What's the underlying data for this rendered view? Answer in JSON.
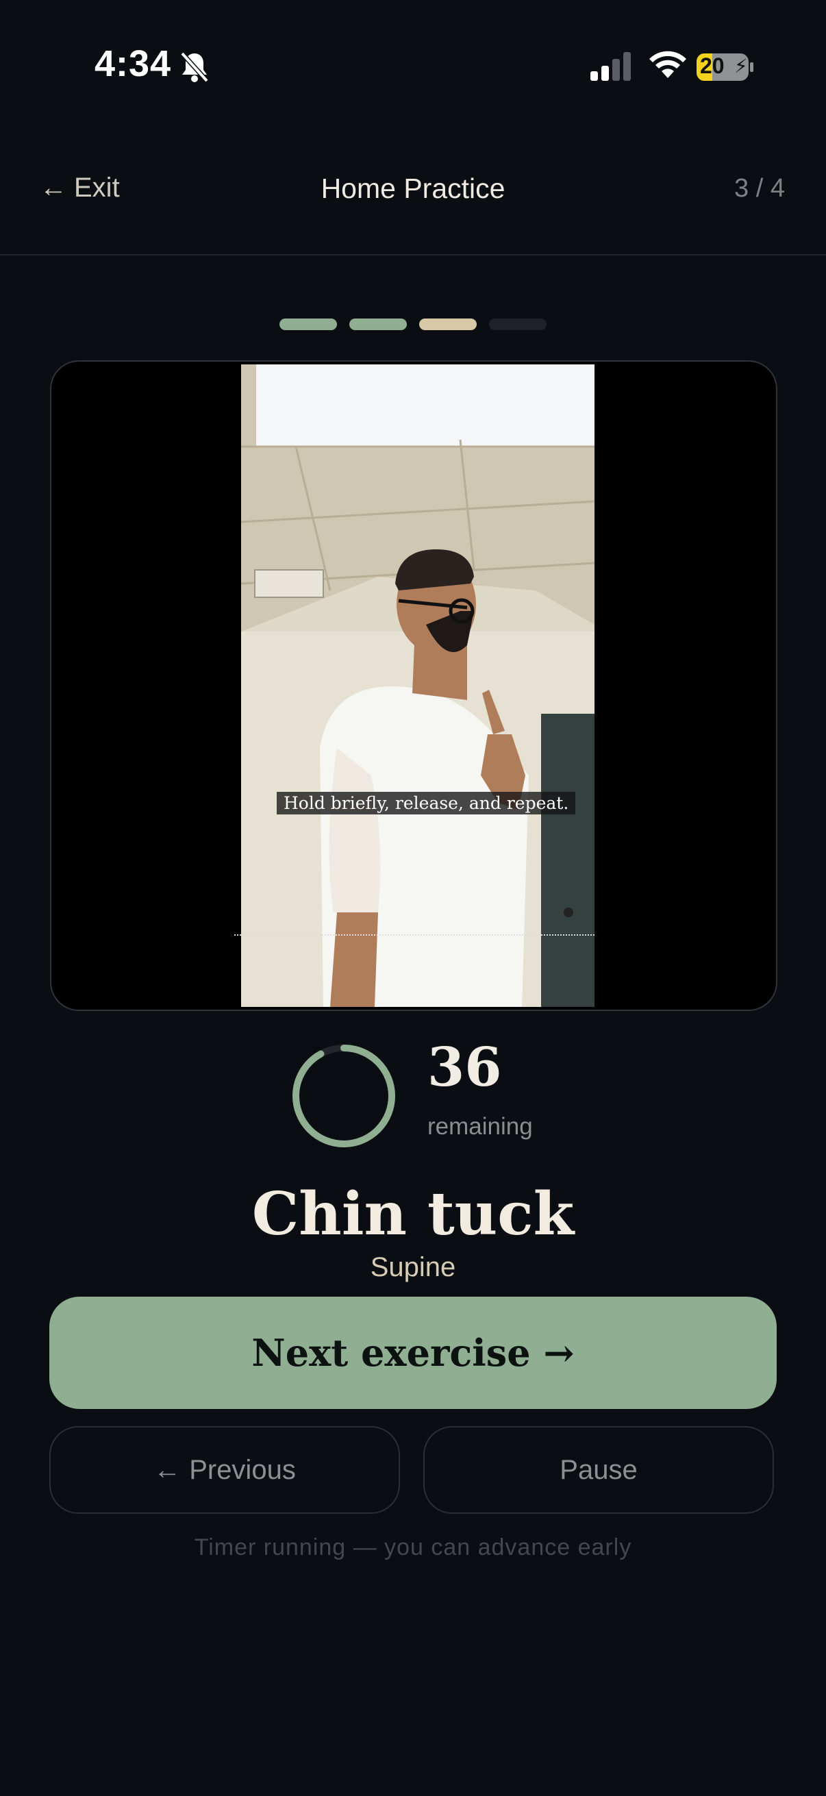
{
  "status_bar": {
    "time": "4:34",
    "battery_level": "20",
    "icons": [
      "bell-slash-icon",
      "cellular-signal-icon",
      "wifi-icon",
      "battery-charging-icon"
    ]
  },
  "header": {
    "exit_label": "Exit",
    "title": "Home Practice",
    "step_counter": "3 / 4"
  },
  "progress": {
    "total_steps": 4,
    "current_step": 3,
    "colors": {
      "done": "#8fae92",
      "current": "#d9c8a8",
      "upcoming": "#1e2228"
    }
  },
  "video": {
    "caption": "Hold briefly, release, and repeat."
  },
  "timer": {
    "seconds_remaining": "36",
    "remaining_label": "remaining",
    "ring_fraction": 0.92,
    "ring_color": "#8fae92"
  },
  "exercise": {
    "name": "Chin tuck",
    "variant": "Supine"
  },
  "actions": {
    "next_label": "Next exercise →",
    "previous_label": "Previous",
    "pause_label": "Pause",
    "hint": "Timer running — you can advance early"
  },
  "colors": {
    "background": "#0a0d12",
    "accent": "#8fae92"
  }
}
